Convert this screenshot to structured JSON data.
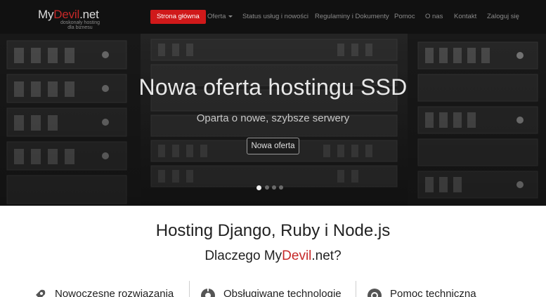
{
  "brand": {
    "name_prefix": "My",
    "name_accent": "Devil",
    "name_suffix": ".net",
    "tagline_line1": "doskonały hosting",
    "tagline_line2": "dla biznesu",
    "accent_color": "#c62828"
  },
  "nav": {
    "items": [
      {
        "label": "Strona główna",
        "active": true
      },
      {
        "label": "Oferta",
        "dropdown": true
      },
      {
        "label": "Status usług i nowości"
      },
      {
        "label": "Regulaminy i Dokumenty"
      },
      {
        "label": "Pomoc"
      },
      {
        "label": "O nas"
      },
      {
        "label": "Kontakt"
      },
      {
        "label": "Zaloguj się"
      }
    ]
  },
  "hero": {
    "title": "Nowa oferta hostingu SSD",
    "subtitle": "Oparta o nowe, szybsze serwery",
    "button_label": "Nowa oferta",
    "slide_count": 4,
    "active_slide": 1
  },
  "content": {
    "title": "Hosting Django, Ruby i Node.js",
    "why_prefix": "Dlaczego My",
    "why_accent": "Devil",
    "why_suffix": ".net?",
    "features": [
      {
        "label": "Nowoczesne rozwiązania",
        "icon": "rocket-icon"
      },
      {
        "label": "Obsługiwane technologie",
        "icon": "cogs-icon"
      },
      {
        "label": "Pomoc techniczna",
        "icon": "lifebuoy-icon"
      }
    ]
  }
}
